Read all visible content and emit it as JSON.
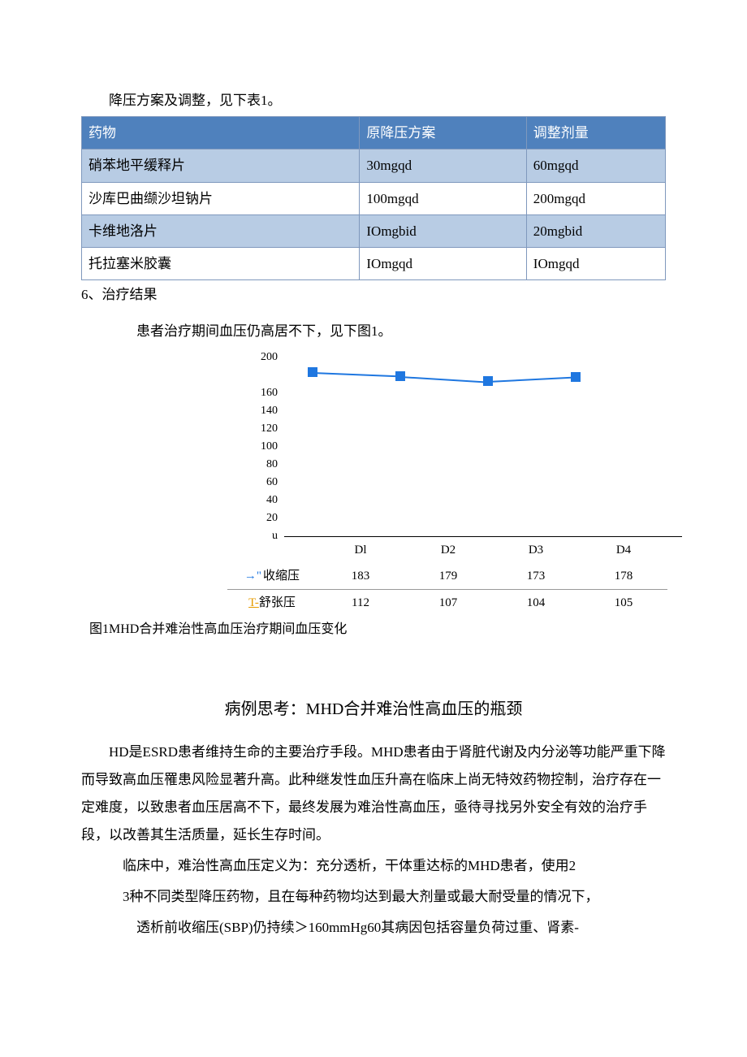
{
  "intro": "降压方案及调整，见下表1。",
  "table": {
    "headers": [
      "药物",
      "原降压方案",
      "调整剂量"
    ],
    "rows": [
      [
        "硝苯地平缓释片",
        "30mgqd",
        "60mgqd"
      ],
      [
        "沙库巴曲缬沙坦钠片",
        "100mgqd",
        "200mgqd"
      ],
      [
        "卡维地洛片",
        "IOmgbid",
        "20mgbid"
      ],
      [
        "托拉塞米胶囊",
        "IOmgqd",
        "IOmgqd"
      ]
    ]
  },
  "section6": "6、治疗结果",
  "result_line": "患者治疗期间血压仍高居不下，见下图1。",
  "chart_data": {
    "type": "line",
    "categories": [
      "Dl",
      "D2",
      "D3",
      "D4"
    ],
    "series": [
      {
        "name": "收缩压",
        "values": [
          183,
          179,
          173,
          178
        ]
      },
      {
        "name": "舒张压",
        "values": [
          112,
          107,
          104,
          105
        ]
      }
    ],
    "ylim": [
      0,
      200
    ],
    "yticks": [
      200,
      160,
      140,
      120,
      100,
      80,
      60,
      40,
      20,
      "u"
    ],
    "xlabel": "",
    "ylabel": "",
    "title": ""
  },
  "fig_caption": "图1MHD合并难治性高血压治疗期间血压变化",
  "case_title": "病例思考：MHD合并难治性高血压的瓶颈",
  "para1": "HD是ESRD患者维持生命的主要治疗手段。MHD患者由于肾脏代谢及内分泌等功能严重下降而导致高血压罹患风险显著升高。此种继发性血压升高在临床上尚无特效药物控制，治疗存在一定难度，以致患者血压居高不下，最终发展为难治性高血压，亟待寻找另外安全有效的治疗手段，以改善其生活质量，延长生存时间。",
  "para2": "临床中，难治性高血压定义为：充分透析，干体重达标的MHD患者，使用2",
  "para3": "3种不同类型降压药物，且在每种药物均达到最大剂量或最大耐受量的情况下，",
  "para4": "透析前收缩压(SBP)仍持续＞160mmHg60其病因包括容量负荷过重、肾素-"
}
